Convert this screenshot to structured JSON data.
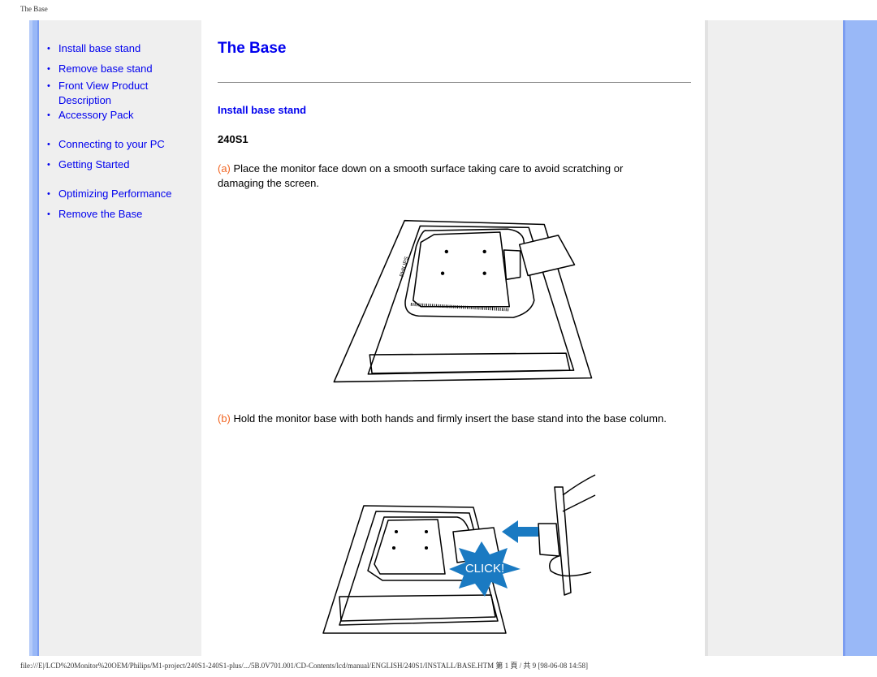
{
  "page_header": "The Base",
  "page_footer": "file:///E|/LCD%20Monitor%20OEM/Philips/M1-project/240S1-240S1-plus/.../5B.0V701.001/CD-Contents/lcd/manual/ENGLISH/240S1/INSTALL/BASE.HTM 第 1 頁 / 共 9 [98-06-08 14:58]",
  "nav": {
    "items": [
      {
        "label": "Install base stand"
      },
      {
        "label": "Remove base stand"
      },
      {
        "label": "Front View Product Description"
      },
      {
        "label": "Accessory Pack"
      },
      {
        "label": "Connecting to your PC"
      },
      {
        "label": "Getting Started"
      },
      {
        "label": "Optimizing Performance"
      },
      {
        "label": "Remove the Base"
      }
    ],
    "bullet": "•"
  },
  "main": {
    "title": "The Base",
    "section_title": "Install base stand",
    "model": "240S1",
    "steps": [
      {
        "marker": "(a)",
        "text": " Place the monitor face down on a smooth surface taking care to avoid scratching or damaging the screen."
      },
      {
        "marker": "(b)",
        "text": " Hold the monitor base with both hands and firmly insert the base stand into the base column."
      }
    ],
    "click_label": "CLICK!"
  },
  "colors": {
    "link": "#0000ee",
    "step_marker": "#f26522",
    "frame_blue": "#99b8f7",
    "nav_bg": "#efefef",
    "click_burst": "#1a7ac2"
  }
}
